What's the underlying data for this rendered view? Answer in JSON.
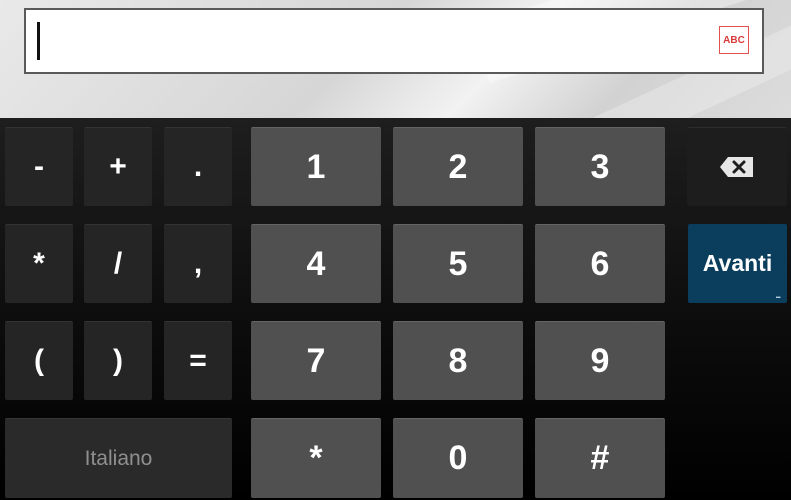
{
  "input": {
    "value": "",
    "spellcheck_badge": "ABC"
  },
  "keyboard": {
    "sym_row1": [
      "-",
      "+",
      "."
    ],
    "sym_row2": [
      "*",
      "/",
      ","
    ],
    "sym_row3": [
      "(",
      ")",
      "="
    ],
    "digits_row1": [
      "1",
      "2",
      "3"
    ],
    "digits_row2": [
      "4",
      "5",
      "6"
    ],
    "digits_row3": [
      "7",
      "8",
      "9"
    ],
    "digits_row4": [
      "*",
      "0",
      "#"
    ],
    "language_label": "Italiano",
    "enter_label": "Avanti",
    "enter_more_indicator": "..."
  },
  "colors": {
    "enter_key": "#0b3d5c",
    "digit_key": "#505050",
    "symbol_key": "#252525",
    "spellcheck_badge": "#d93a3a"
  }
}
